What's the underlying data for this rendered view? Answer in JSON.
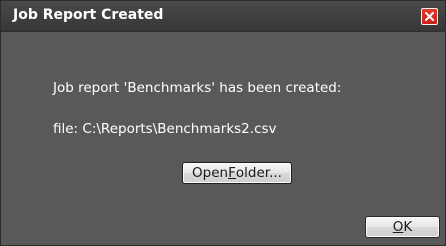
{
  "dialog": {
    "title": "Job Report Created",
    "message_line1": "Job report 'Benchmarks' has been created:",
    "message_line2": "file: C:\\Reports\\Benchmarks2.csv",
    "open_folder_button": {
      "pre": "Open ",
      "mnemonic": "F",
      "post": "older..."
    },
    "ok_button": {
      "pre": "",
      "mnemonic": "O",
      "post": "K"
    },
    "close_icon": "close-icon"
  },
  "colors": {
    "body_bg": "#595959",
    "titlebar_bg": "#3f3f3f",
    "close_button_bg": "#d22b22",
    "text": "#ffffff",
    "button_bg": "#e6e6e6"
  }
}
